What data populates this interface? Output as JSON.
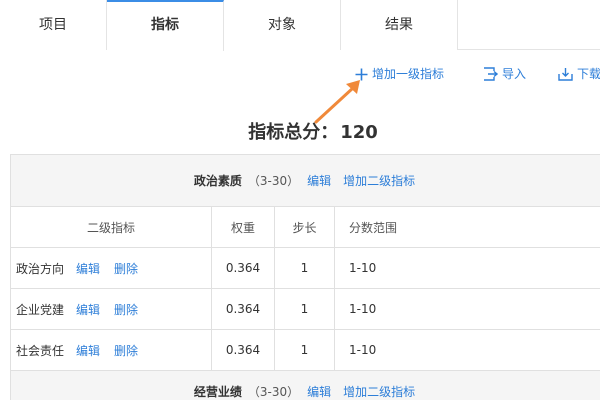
{
  "tabs": [
    {
      "label": "项目"
    },
    {
      "label": "指标"
    },
    {
      "label": "对象"
    },
    {
      "label": "结果"
    }
  ],
  "toolbar": {
    "add_label": "增加一级指标",
    "import_label": "导入",
    "download_label": "下载"
  },
  "total": {
    "label": "指标总分：",
    "value": "120"
  },
  "sections": [
    {
      "title": "政治素质",
      "range": "（3-30）",
      "edit": "编辑",
      "add": "增加二级指标",
      "columns": [
        "二级指标",
        "权重",
        "步长",
        "分数范围"
      ],
      "rows": [
        {
          "name": "政治方向",
          "edit": "编辑",
          "delete": "删除",
          "weight": "0.364",
          "step": "1",
          "range": "1-10"
        },
        {
          "name": "企业党建",
          "edit": "编辑",
          "delete": "删除",
          "weight": "0.364",
          "step": "1",
          "range": "1-10"
        },
        {
          "name": "社会责任",
          "edit": "编辑",
          "delete": "删除",
          "weight": "0.364",
          "step": "1",
          "range": "1-10"
        }
      ]
    },
    {
      "title": "经营业绩",
      "range": "（3-30）",
      "edit": "编辑",
      "add": "增加二级指标"
    }
  ],
  "colors": {
    "accent": "#2d7ed8",
    "arrow": "#f0893a",
    "active_tab_border": "#3b8de6"
  }
}
